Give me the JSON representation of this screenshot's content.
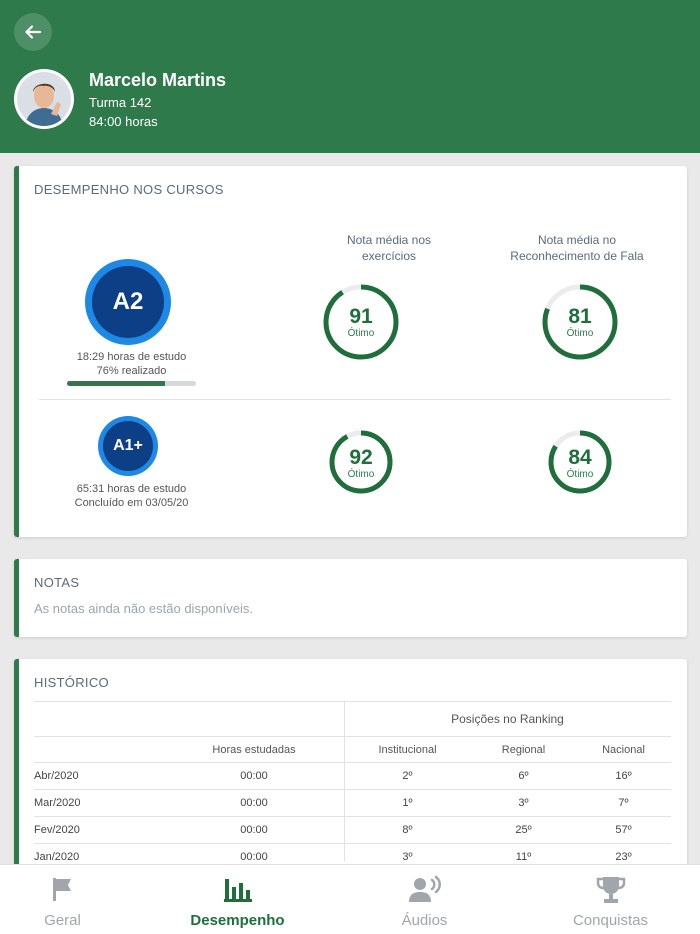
{
  "profile": {
    "name": "Marcelo Martins",
    "class": "Turma 142",
    "hours": "84:00 horas"
  },
  "performance": {
    "title": "DESEMPENHO NOS CURSOS",
    "col_exercises": [
      "Nota média nos",
      "exercícios"
    ],
    "col_speech": [
      "Nota média no",
      "Reconhecimento de Fala"
    ],
    "courses": [
      {
        "level": "A2",
        "line1": "18:29 horas de estudo",
        "line2": "76% realizado",
        "progress": 0.76,
        "exercise_score": "91",
        "exercise_fraction": 0.91,
        "exercise_label": "Ótimo",
        "speech_score": "81",
        "speech_fraction": 0.81,
        "speech_label": "Ótimo"
      },
      {
        "level": "A1+",
        "line1": "65:31 horas de estudo",
        "line2": "Concluído em 03/05/20",
        "exercise_score": "92",
        "exercise_fraction": 0.92,
        "exercise_label": "Ótimo",
        "speech_score": "84",
        "speech_fraction": 0.84,
        "speech_label": "Ótimo"
      }
    ]
  },
  "notes": {
    "title": "NOTAS",
    "message": "As notas ainda não estão disponíveis."
  },
  "history": {
    "title": "HISTÓRICO",
    "group_header": "Posições no Ranking",
    "columns": [
      "",
      "Horas estudadas",
      "Institucional",
      "Regional",
      "Nacional"
    ],
    "rows": [
      [
        "Abr/2020",
        "00:00",
        "2º",
        "6º",
        "16º"
      ],
      [
        "Mar/2020",
        "00:00",
        "1º",
        "3º",
        "7º"
      ],
      [
        "Fev/2020",
        "00:00",
        "8º",
        "25º",
        "57º"
      ],
      [
        "Jan/2020",
        "00:00",
        "3º",
        "11º",
        "23º"
      ]
    ]
  },
  "nav": {
    "items": [
      "Geral",
      "Desempenho",
      "Áudios",
      "Conquistas"
    ],
    "active": "Desempenho"
  },
  "colors": {
    "brand": "#2e7a4b",
    "ring": "#1f6e3c",
    "badge_outer": "#1e88e5",
    "badge_inner": "#0c3f86"
  },
  "icons": {
    "back": "arrow-left-icon",
    "geral": "flag-icon",
    "desempenho": "bar-chart-icon",
    "audios": "speaking-person-icon",
    "conquistas": "trophy-icon"
  }
}
